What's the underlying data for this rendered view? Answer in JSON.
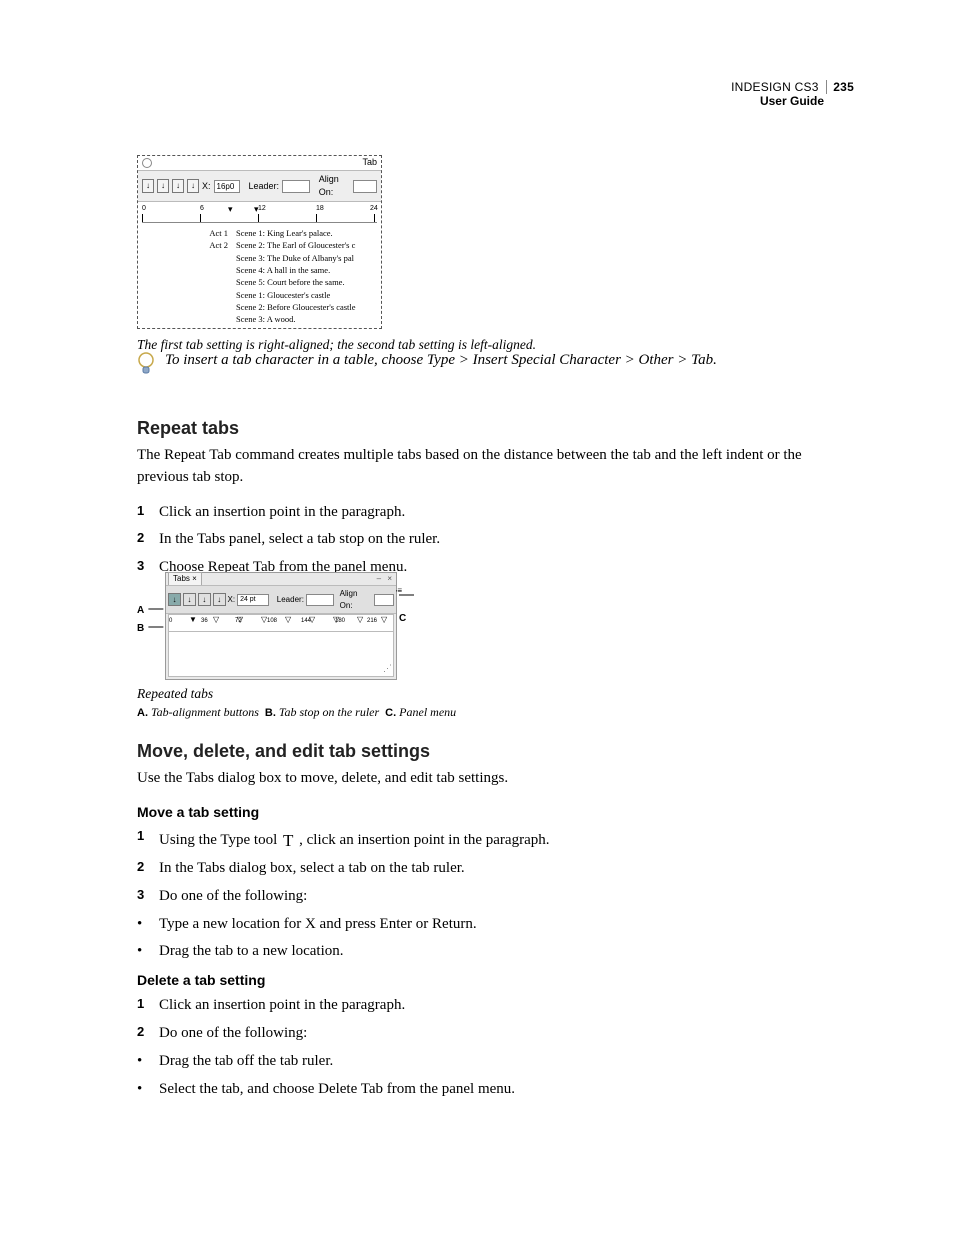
{
  "header": {
    "product": "INDESIGN CS3",
    "page_number": "235",
    "doc": "User Guide"
  },
  "fig1": {
    "tab_label": "Tab",
    "x_label": "X:",
    "x_value": "16p0",
    "leader_label": "Leader:",
    "align_label": "Align On:",
    "ruler_labels": [
      "0",
      "6",
      "12",
      "18",
      "24"
    ],
    "left_col": [
      "Act 1",
      "",
      "",
      "",
      "",
      "Act 2",
      "",
      ""
    ],
    "right_col": [
      "Scene 1: King Lear's palace.",
      "Scene 2: The Earl of Gloucester's c",
      "Scene 3: The Duke of Albany's pal",
      "Scene 4: A hall in the same.",
      "Scene 5: Court before the same.",
      "Scene 1: Gloucester's castle",
      "Scene 2: Before Gloucester's castle",
      "Scene 3: A wood."
    ],
    "caption": "The first tab setting is right-aligned; the second tab setting is left-aligned."
  },
  "tip": {
    "text": "To insert a tab character in a table, choose Type > Insert Special Character > Other > Tab."
  },
  "section1": {
    "heading": "Repeat tabs",
    "body": "The Repeat Tab command creates multiple tabs based on the distance between the tab and the left indent or the previous tab stop.",
    "steps": [
      "Click an insertion point in the paragraph.",
      "In the Tabs panel, select a tab stop on the ruler.",
      "Choose Repeat Tab from the panel menu."
    ]
  },
  "fig2": {
    "panel_title": "Tabs",
    "x_label": "X:",
    "x_value": "24 pt",
    "leader_label": "Leader:",
    "align_label": "Align On:",
    "ruler_labels": [
      "0",
      "36",
      "72",
      "108",
      "144",
      "180",
      "216"
    ],
    "caption": "Repeated tabs",
    "legend_a": "Tab-alignment buttons",
    "legend_b": "Tab stop on the ruler",
    "legend_c": "Panel menu"
  },
  "section2": {
    "heading": "Move, delete, and edit tab settings",
    "body": "Use the Tabs dialog box to move, delete, and edit tab settings."
  },
  "move": {
    "heading": "Move a tab setting",
    "step1_before": "Using the Type tool ",
    "step1_after": " , click an insertion point in the paragraph.",
    "steps_rest": [
      "In the Tabs dialog box, select a tab on the tab ruler.",
      "Do one of the following:"
    ],
    "bullets": [
      "Type a new location for X and press Enter or Return.",
      "Drag the tab to a new location."
    ]
  },
  "del": {
    "heading": "Delete a tab setting",
    "steps": [
      "Click an insertion point in the paragraph.",
      "Do one of the following:"
    ],
    "bullets": [
      "Drag the tab off the tab ruler.",
      "Select the tab, and choose Delete Tab from the panel menu."
    ]
  }
}
